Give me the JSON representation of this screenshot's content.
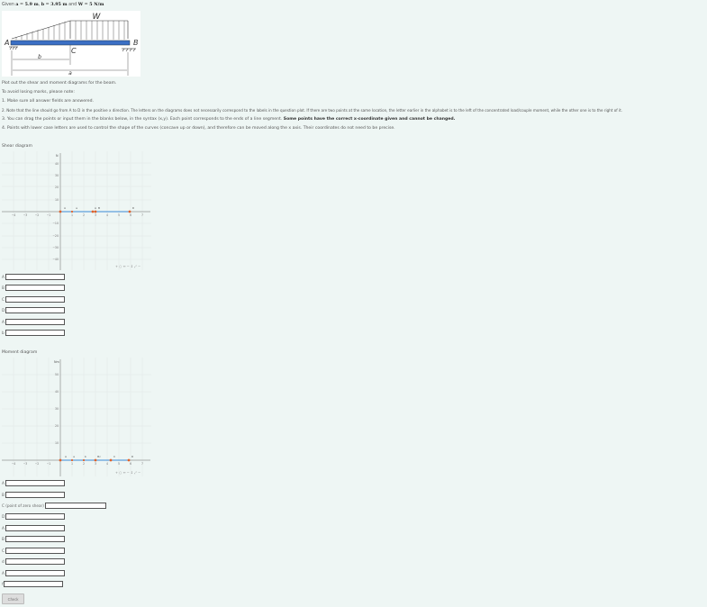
{
  "given": {
    "prefix": "Given",
    "a_sym": "a",
    "a_val": "5.9 m",
    "b_sym": "b",
    "b_val": "3.95 m",
    "and": "and",
    "w_sym": "W",
    "w_val": "5 N/m"
  },
  "figure": {
    "load_label": "W",
    "left_label": "A",
    "right_label": "B",
    "mid_label": "C",
    "dim_b": "b",
    "dim_a": "a"
  },
  "instructions": {
    "plot": "Plot out the shear and moment diagrams for the beam.",
    "avoid": "To avoid losing marks, please note:",
    "n1": "1. Make sure all answer fields are answered.",
    "n2": "2. Note that the line should go from A to D in the positive x direction. The letters on the diagrams does not necessarily correspond to the labels in the question plot. If there are two points at the same location, the letter earlier in the alphabet is to the left of the concentrated load/couple moment, while the other one is to the right of it.",
    "n3_plain": "3. You can drag the points or input them in the blanks below, in the syntax (x,y). Each point corresponds to the ends of a line segment.",
    "n3_bold": "Some points have the correct x-coordinate given and cannot be changed.",
    "n4": "4. Points with lower case letters are used to control the shape of the curves (concave up or down), and therefore can be moved along the x axis. Their coordinates do not need to be precise."
  },
  "shear": {
    "title": "Shear diagram",
    "y_axis_label": "N",
    "y_ticks": [
      "40",
      "30",
      "20",
      "10",
      "−10",
      "−20",
      "−30",
      "−40"
    ],
    "x_ticks": [
      "−4",
      "−3",
      "−2",
      "−1",
      "1",
      "2",
      "3",
      "4",
      "5",
      "6",
      "7"
    ],
    "points": [
      "A",
      "a",
      "A",
      "B",
      "D"
    ],
    "controls": "+ ○ ↔ − ↕ ⤢ −",
    "fields": [
      "A",
      "B",
      "C",
      "D",
      "A",
      "b"
    ]
  },
  "moment": {
    "title": "Moment diagram",
    "y_axis_label": "Nm",
    "y_ticks": [
      "50",
      "40",
      "30",
      "20",
      "10"
    ],
    "x_ticks": [
      "−4",
      "−3",
      "−2",
      "−1",
      "1",
      "2",
      "3",
      "4",
      "5",
      "6",
      "7"
    ],
    "points": [
      "A",
      "a",
      "b",
      "Bc",
      "C",
      "D"
    ],
    "controls": "+ ○ ↔ − ↕ ⤢ −",
    "fields": [
      "A",
      "B",
      "C (point of zero shear)",
      "D",
      "A",
      "B",
      "C",
      "d",
      "A",
      "f"
    ]
  },
  "check_label": "Check",
  "colors": {
    "point": "#e0622a",
    "line": "#3a8ad6",
    "beam": "#3b6fc4"
  }
}
